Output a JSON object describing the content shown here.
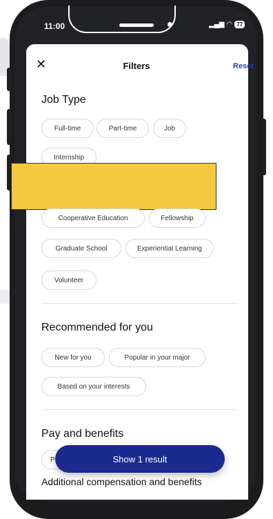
{
  "status": {
    "time": "11:00",
    "battery": "77"
  },
  "header": {
    "title": "Filters",
    "reset_label": "Reset"
  },
  "sections": {
    "job_type": {
      "title": "Job Type",
      "chips": [
        "Full-time",
        "Part-time",
        "Job",
        "Internship",
        "Cooperative Education",
        "Fellowship",
        "Graduate School",
        "Experiential Learning",
        "Volunteer"
      ]
    },
    "recommended": {
      "title": "Recommended for you",
      "chips": [
        "New for you",
        "Popular in your major",
        "Based on your interests"
      ]
    },
    "pay": {
      "title": "Pay and benefits",
      "partial_chip": "P"
    },
    "additional": {
      "title": "Additional compensation and benefits"
    }
  },
  "show_button_label": "Show 1 result",
  "colors": {
    "accent": "#1b2a8f",
    "reset": "#2b3fa8",
    "redaction": "#f5c93f"
  }
}
